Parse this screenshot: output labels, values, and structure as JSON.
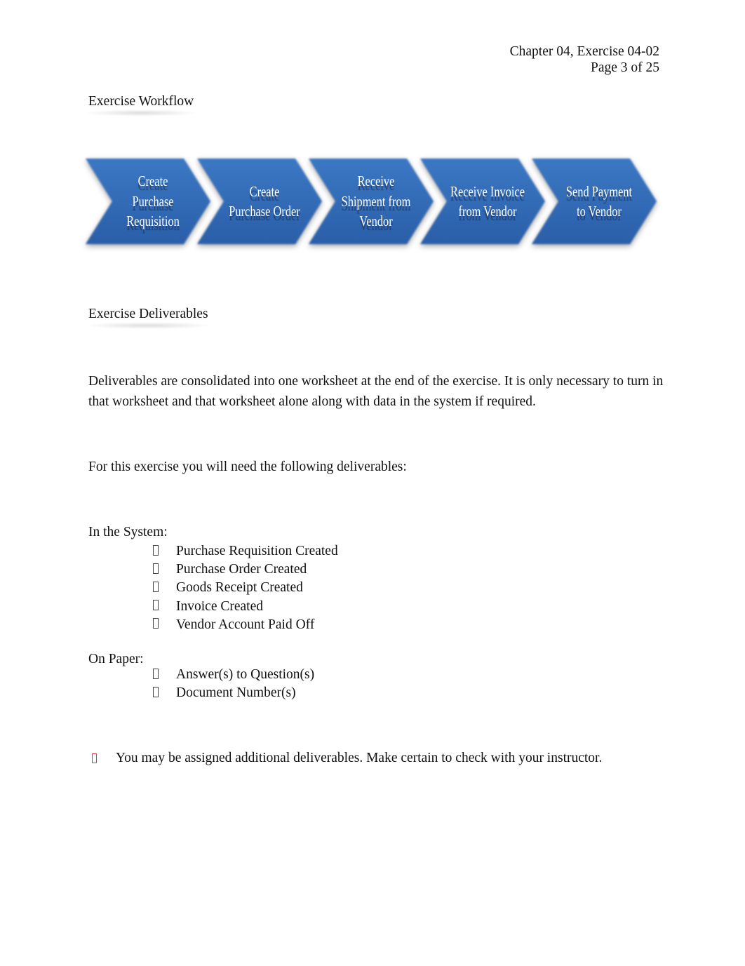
{
  "header": {
    "chapter_line": "Chapter 04, Exercise 04-02",
    "page_line": "Page 3 of 25"
  },
  "workflow": {
    "title": "Exercise Workflow",
    "color_top": "#3b78c4",
    "color_bottom": "#2a5ea8",
    "steps": [
      {
        "label_lines": [
          "Create",
          "Purchase",
          "Requisition"
        ]
      },
      {
        "label_lines": [
          "Create",
          "Purchase Order"
        ]
      },
      {
        "label_lines": [
          "Receive",
          "Shipment from",
          "Vendor"
        ]
      },
      {
        "label_lines": [
          "Receive Invoice",
          "from Vendor"
        ]
      },
      {
        "label_lines": [
          "Send Payment",
          "to Vendor"
        ]
      }
    ]
  },
  "deliverables": {
    "title": "Exercise Deliverables",
    "intro": "Deliverables are consolidated into one worksheet at the end of the exercise. It is only necessary to turn in that worksheet and that worksheet alone along with data in the system if required.",
    "lead": "For this exercise you will need the following deliverables:",
    "system_label": "In the System:",
    "system_items": [
      "Purchase Requisition Created",
      "Purchase Order Created",
      "Goods Receipt Created",
      "Invoice Created",
      "Vendor Account Paid Off"
    ],
    "paper_label": "On Paper:",
    "paper_items": [
      "Answer(s) to Question(s)",
      "Document Number(s)"
    ],
    "note": "You may be assigned additional deliverables. Make certain to check with your instructor.",
    "note_bullet_color": "#e33333"
  }
}
